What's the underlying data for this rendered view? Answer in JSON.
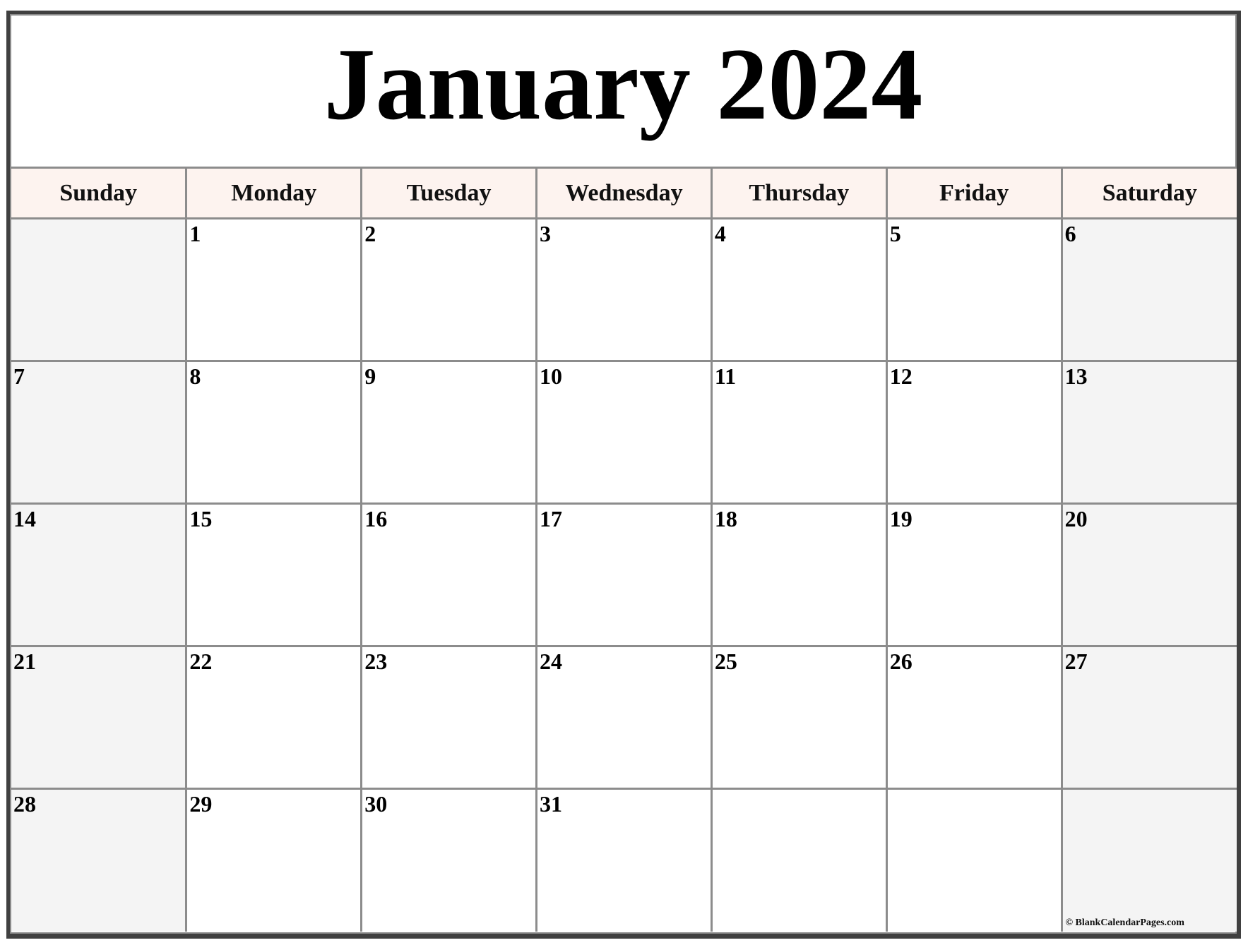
{
  "calendar": {
    "title": "January 2024",
    "weekdays": [
      "Sunday",
      "Monday",
      "Tuesday",
      "Wednesday",
      "Thursday",
      "Friday",
      "Saturday"
    ],
    "weeks": [
      [
        "",
        "1",
        "2",
        "3",
        "4",
        "5",
        "6"
      ],
      [
        "7",
        "8",
        "9",
        "10",
        "11",
        "12",
        "13"
      ],
      [
        "14",
        "15",
        "16",
        "17",
        "18",
        "19",
        "20"
      ],
      [
        "21",
        "22",
        "23",
        "24",
        "25",
        "26",
        "27"
      ],
      [
        "28",
        "29",
        "30",
        "31",
        "",
        "",
        ""
      ]
    ],
    "credit": "© BlankCalendarPages.com"
  },
  "colors": {
    "header_bg": "#fdf3ef",
    "weekend_bg": "#f4f4f4",
    "grid_line": "#8c8c8c",
    "frame": "#404040"
  }
}
